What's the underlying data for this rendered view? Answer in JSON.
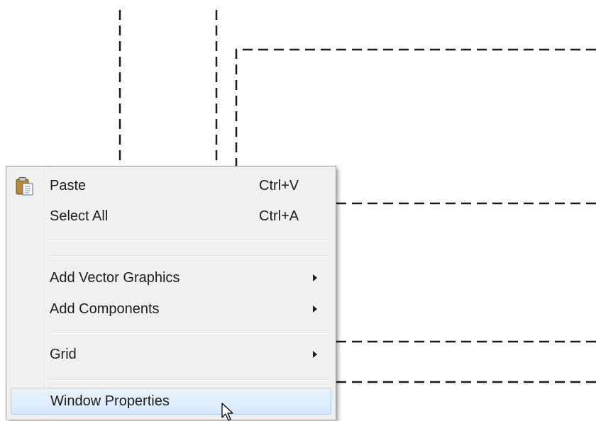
{
  "context_menu": {
    "items": [
      {
        "label": "Paste",
        "shortcut": "Ctrl+V",
        "icon": "paste-icon"
      },
      {
        "label": "Select All",
        "shortcut": "Ctrl+A"
      },
      {
        "label": "Add Vector Graphics",
        "submenu": true
      },
      {
        "label": "Add Components",
        "submenu": true
      },
      {
        "label": "Grid",
        "submenu": true
      },
      {
        "label": "Window Properties",
        "highlighted": true
      }
    ]
  },
  "cursor": {
    "icon": "arrow-cursor-icon"
  }
}
